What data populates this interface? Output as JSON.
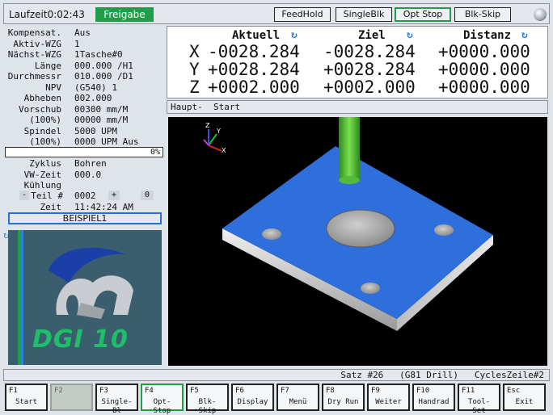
{
  "topbar": {
    "runtime_label": "Laufzeit",
    "runtime_value": "0:02:43",
    "status_badge": "Freigabe",
    "buttons": [
      "FeedHold",
      "SingleBlk",
      "Opt Stop",
      "Blk-Skip"
    ]
  },
  "left": {
    "rows": [
      {
        "label": "Kompensat.",
        "value": "Aus"
      },
      {
        "label": "Aktiv-WZG",
        "value": "1"
      },
      {
        "label": "Nächst-WZG",
        "value": "1Tasche#0"
      },
      {
        "label": "Länge",
        "value": "000.000 /H1"
      },
      {
        "label": "Durchmessr",
        "value": "010.000 /D1"
      },
      {
        "label": "NPV",
        "value": "(G540) 1"
      },
      {
        "label": "Abheben",
        "value": "002.000"
      },
      {
        "label": "Vorschub",
        "value": "00300 mm/M"
      },
      {
        "label": "(100%)",
        "value": "00000 mm/M"
      },
      {
        "label": "Spindel",
        "value": "5000 UPM"
      },
      {
        "label": "(100%)",
        "value": "0000 UPM Aus"
      }
    ],
    "progress_percent": 0,
    "progress_text": "0%",
    "rows2": [
      {
        "label": "Zyklus",
        "value": "Bohren"
      },
      {
        "label": "VW-Zeit",
        "value": "000.0"
      },
      {
        "label": "Kühlung",
        "value": ""
      }
    ],
    "teil_label": "Teil #",
    "teil_minus": "-",
    "teil_value": "0002",
    "teil_plus": "+",
    "teil_reset": "0",
    "zeit_label": "Zeit",
    "zeit_value": "11:42:24 AM",
    "program_name": "BEISPIEL1",
    "logo_text": "DGI 10"
  },
  "dro": {
    "headers": [
      "Aktuell",
      "Ziel",
      "Distanz"
    ],
    "axes": [
      {
        "axis": "X",
        "aktuell": "-0028.284",
        "ziel": "-0028.284",
        "distanz": "+0000.000"
      },
      {
        "axis": "Y",
        "aktuell": "+0028.284",
        "ziel": "+0028.284",
        "distanz": "+0000.000"
      },
      {
        "axis": "Z",
        "aktuell": "+0002.000",
        "ziel": "+0002.000",
        "distanz": "+0000.000"
      }
    ]
  },
  "status_line": "Haupt-  Start",
  "viewport": {
    "axis_x": "X",
    "axis_y": "Y",
    "axis_z": "Z",
    "plate_color": "#2f6fdc",
    "tool_color": "#58c83a"
  },
  "satz_line": "Satz #26   (G81 Drill)   CyclesZeile#2",
  "fkeys": [
    {
      "key": "F1",
      "label": "Start"
    },
    {
      "key": "F2",
      "label": ""
    },
    {
      "key": "F3",
      "label": "Single-Bl"
    },
    {
      "key": "F4",
      "label": "Opt-Stop"
    },
    {
      "key": "F5",
      "label": "Blk-Skip"
    },
    {
      "key": "F6",
      "label": "Display"
    },
    {
      "key": "F7",
      "label": "Menü"
    },
    {
      "key": "F8",
      "label": "Dry Run"
    },
    {
      "key": "F9",
      "label": "Weiter"
    },
    {
      "key": "F10",
      "label": "Handrad"
    },
    {
      "key": "F11",
      "label": "Tool-Set"
    },
    {
      "key": "Esc",
      "label": "Exit"
    }
  ]
}
